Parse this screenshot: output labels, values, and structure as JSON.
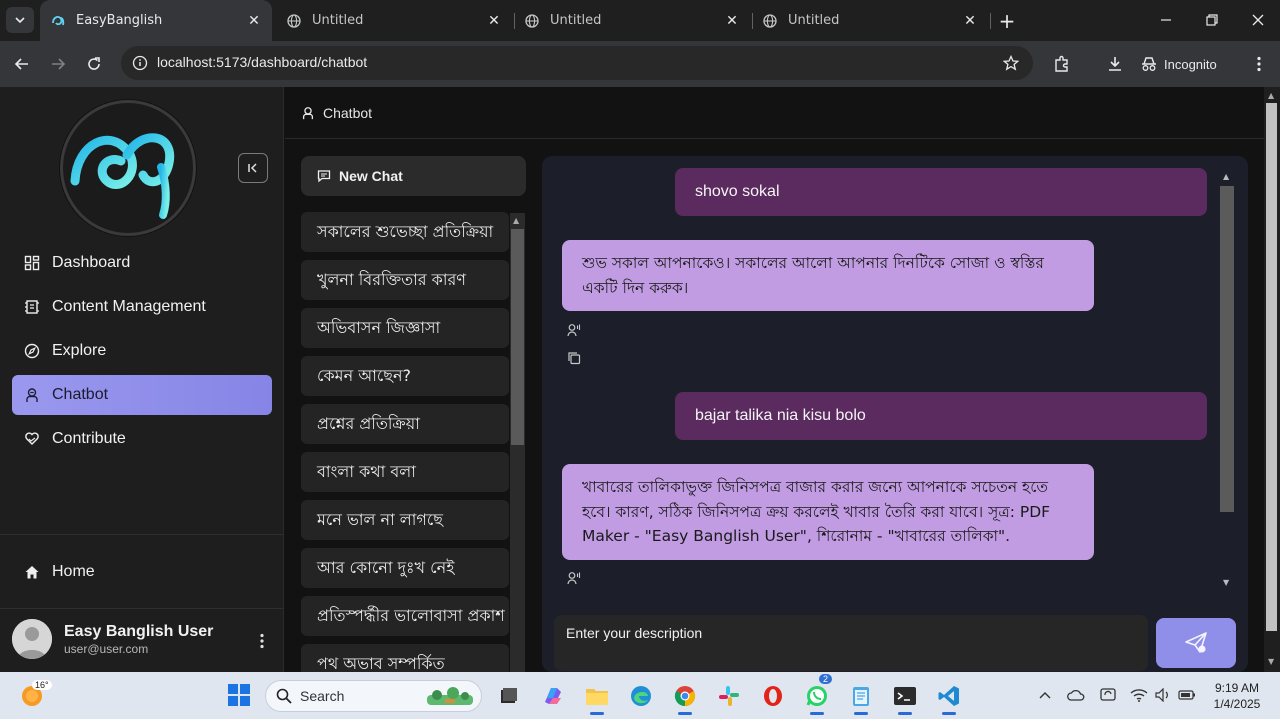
{
  "browser": {
    "tabs": [
      {
        "title": "EasyBanglish",
        "active": true
      },
      {
        "title": "Untitled",
        "active": false
      },
      {
        "title": "Untitled",
        "active": false
      },
      {
        "title": "Untitled",
        "active": false
      }
    ],
    "url": "localhost:5173/dashboard/chatbot",
    "incognito_label": "Incognito"
  },
  "sidebar": {
    "logo_glyph": "অ",
    "items": [
      {
        "label": "Dashboard",
        "icon": "dashboard-icon"
      },
      {
        "label": "Content Management",
        "icon": "content-icon"
      },
      {
        "label": "Explore",
        "icon": "explore-icon"
      },
      {
        "label": "Chatbot",
        "icon": "chatbot-icon",
        "active": true
      },
      {
        "label": "Contribute",
        "icon": "heart-hand-icon"
      }
    ],
    "home_label": "Home",
    "user": {
      "name": "Easy Banglish User",
      "email": "user@user.com"
    }
  },
  "header": {
    "title": "Chatbot"
  },
  "chat": {
    "new_chat_label": "New Chat",
    "history": [
      "সকালের শুভেচ্ছা প্রতিক্রিয়া",
      "খুলনা বিরক্তিতার কারণ",
      "অভিবাসন জিজ্ঞাসা",
      "কেমন আছেন?",
      "প্রশ্নের প্রতিক্রিয়া",
      "বাংলা কথা বলা",
      "মনে ভাল না লাগছে",
      "আর কোনো দুঃখ নেই",
      "প্রতিস্পর্দ্ধীর ভালোবাসা প্রকাশ",
      "পথ অভাব সম্পর্কিত"
    ],
    "messages": [
      {
        "role": "user",
        "text": "shovo sokal"
      },
      {
        "role": "bot",
        "text": "শুভ সকাল আপনাকেও। সকালের আলো আপনার দিনটিকে সোজা ও স্বস্তির একটি দিন করুক।"
      },
      {
        "role": "user",
        "text": "bajar talika nia kisu bolo"
      },
      {
        "role": "bot",
        "text": "খাবারের তালিকাভুক্ত জিনিসপত্র বাজার করার জন্যে আপনাকে সচেতন হতে হবে। কারণ, সঠিক জিনিসপত্র ক্রয় করলেই খাবার তৈরি করা যাবে। সূত্র: PDF Maker - \"Easy Banglish User\", শিরোনাম - \"খাবারের তালিকা\"."
      }
    ],
    "input_placeholder": "Enter your description"
  },
  "taskbar": {
    "weather_temp": "16°",
    "search_placeholder": "Search",
    "whatsapp_badge": "2",
    "time": "9:19 AM",
    "date": "1/4/2025"
  },
  "colors": {
    "accent": "#8f8fe9",
    "user_bubble": "#5b2a5f",
    "bot_bubble": "#c19ce3"
  }
}
